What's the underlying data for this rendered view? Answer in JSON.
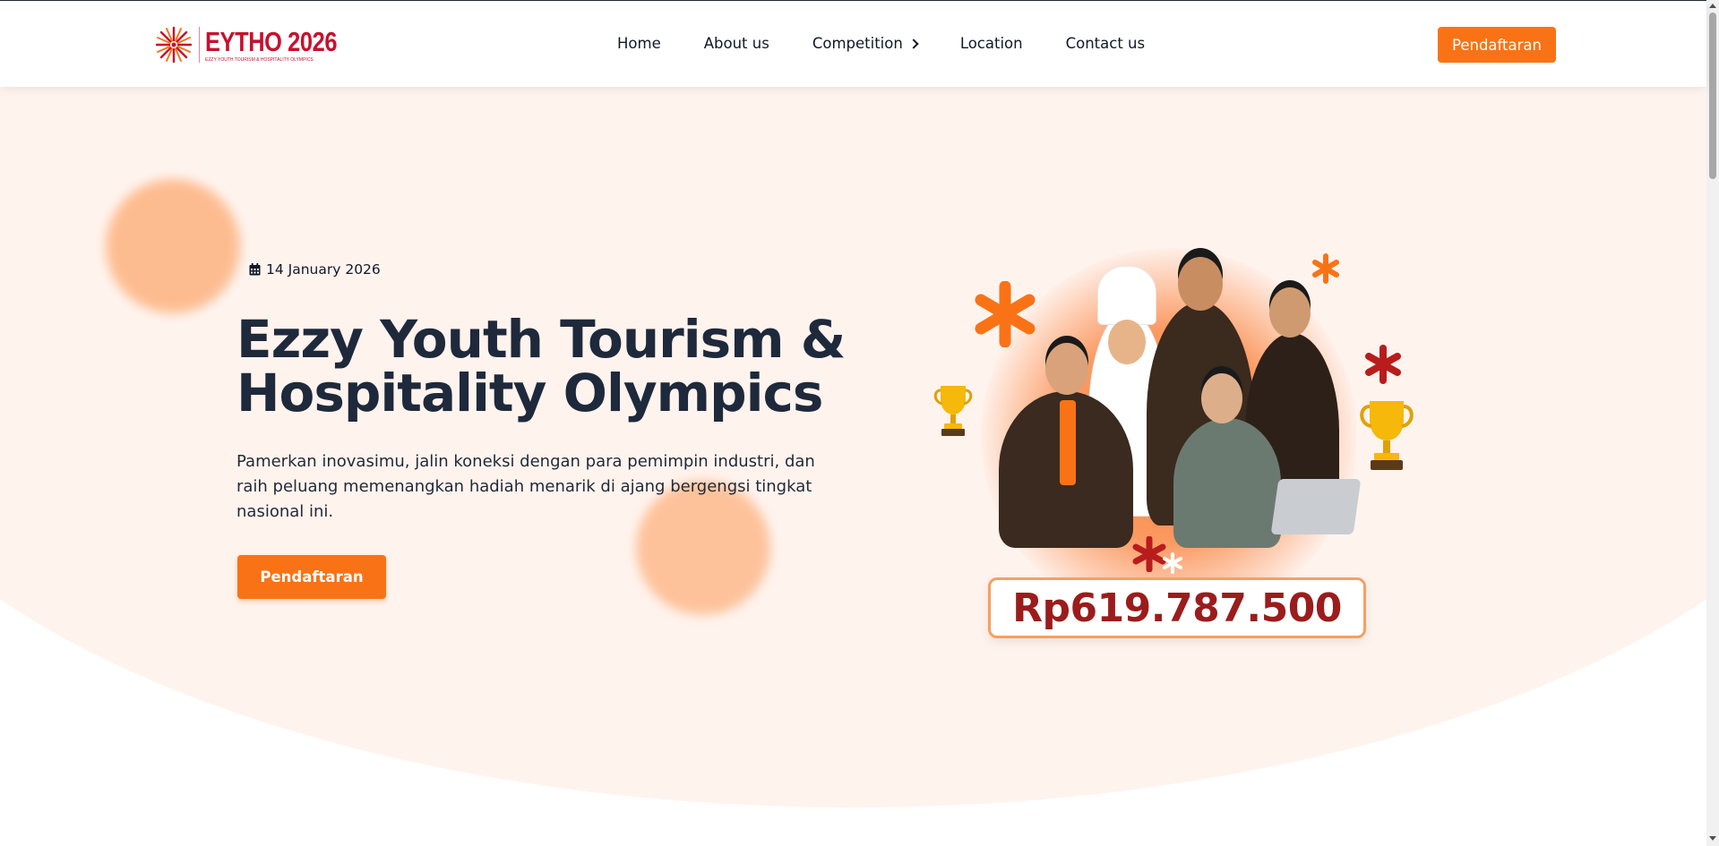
{
  "header": {
    "logo": {
      "title": "EYTHO 2026",
      "subtitle": "EZZY YOUTH TOURISM & HOSPITALITY OLYMPICS",
      "icon": "logo-burst-icon"
    },
    "nav": [
      {
        "label": "Home"
      },
      {
        "label": "About us"
      },
      {
        "label": "Competition",
        "has_dropdown": true
      },
      {
        "label": "Location"
      },
      {
        "label": "Contact us"
      }
    ],
    "cta_label": "Pendaftaran"
  },
  "hero": {
    "date": "14 January 2026",
    "date_icon": "calendar-icon",
    "title_line1": "Ezzy Youth Tourism &",
    "title_line2": "Hospitality Olympics",
    "description": "Pamerkan inovasimu, jalin koneksi dengan para pemimpin industri, dan raih peluang memenangkan hadiah menarik di ajang bergengsi tingkat nasional ini.",
    "cta_label": "Pendaftaran",
    "prize_amount": "Rp619.787.500"
  },
  "colors": {
    "accent": "#f97316",
    "brand_red": "#c8102e",
    "hero_bg": "#fff3ee",
    "title": "#1e293b",
    "prize_text": "#9b1c1c"
  }
}
